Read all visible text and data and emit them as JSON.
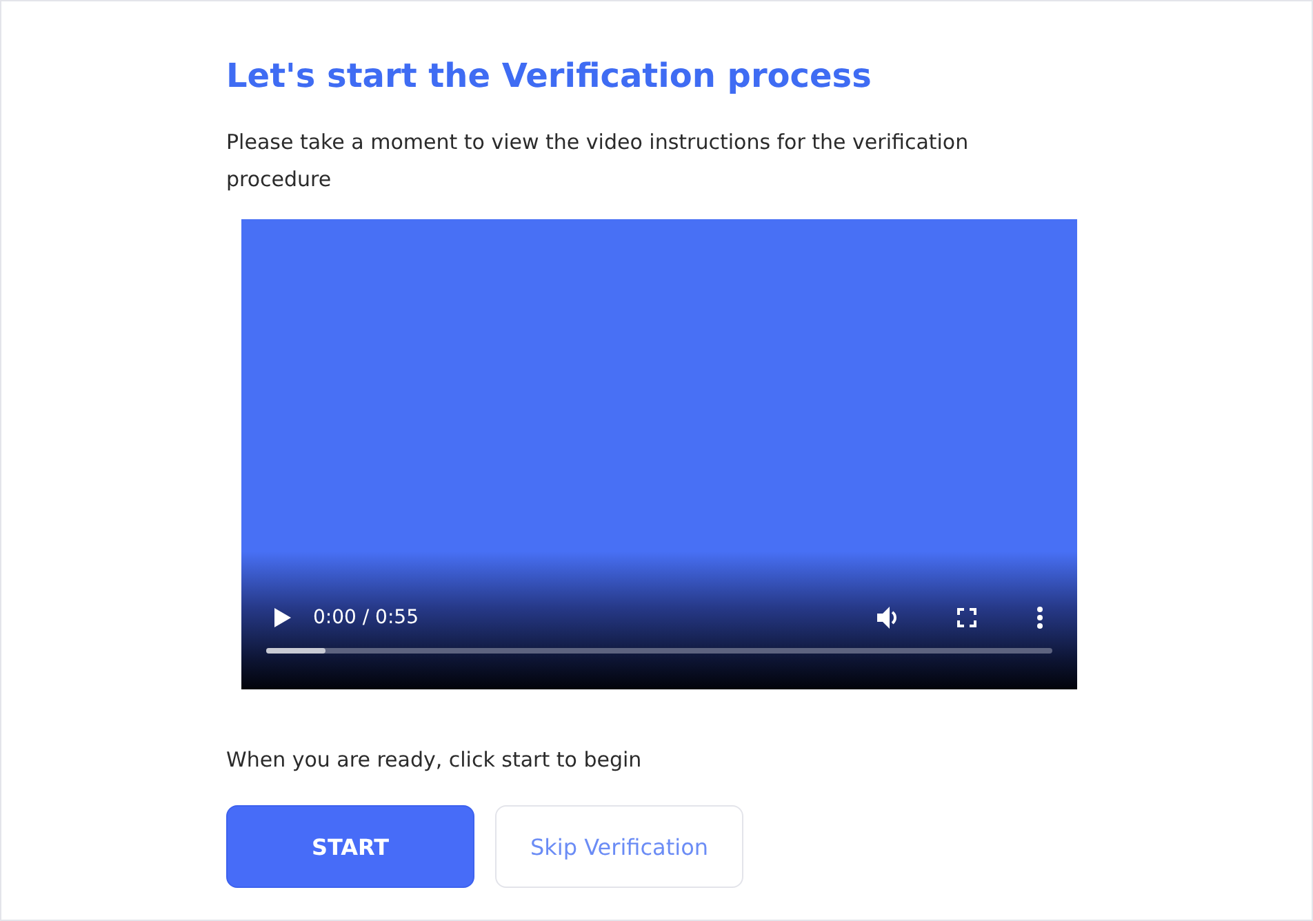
{
  "heading": "Let's start the Verification process",
  "intro": "Please take a moment to view the video instructions for the verification procedure",
  "video": {
    "time": "0:00 / 0:55",
    "progress": {
      "level": 0.075
    }
  },
  "prompt": "When you are ready, click start to begin",
  "buttons": [
    {
      "label": "START",
      "kind": "primary"
    },
    {
      "label": "Skip Verification",
      "kind": "secondary"
    }
  ]
}
